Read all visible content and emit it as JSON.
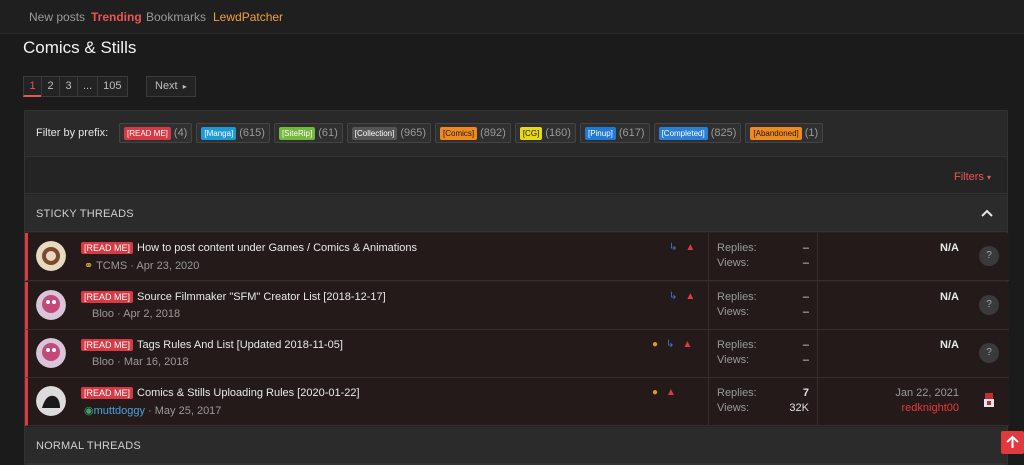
{
  "nav": {
    "new_posts": "New posts",
    "trending": "Trending",
    "bookmarks": "Bookmarks",
    "lewdpatcher": "LewdPatcher"
  },
  "page": {
    "title": "Comics & Stills"
  },
  "pagination": {
    "pages": [
      "1",
      "2",
      "3",
      "...",
      "105"
    ],
    "next": "Next",
    "current": "1"
  },
  "filter": {
    "label": "Filter by prefix:",
    "prefixes": [
      {
        "tag": "[READ ME]",
        "count": "(4)",
        "color": "#d63a44",
        "text_color": "#ffffff"
      },
      {
        "tag": "[Manga]",
        "count": "(615)",
        "color": "#1e9bd7",
        "text_color": "#ffffff"
      },
      {
        "tag": "[SiteRip]",
        "count": "(61)",
        "color": "#74b83c",
        "text_color": "#ffffff"
      },
      {
        "tag": "[Collection]",
        "count": "(965)",
        "color": "#555555",
        "text_color": "#ffffff"
      },
      {
        "tag": "[Comics]",
        "count": "(892)",
        "color": "#f08a1c",
        "text_color": "#1a1a1a"
      },
      {
        "tag": "[CG]",
        "count": "(160)",
        "color": "#e8d81a",
        "text_color": "#1a1a1a"
      },
      {
        "tag": "[Pinup]",
        "count": "(617)",
        "color": "#1e7ad6",
        "text_color": "#ffffff"
      },
      {
        "tag": "[Completed]",
        "count": "(825)",
        "color": "#2a80d6",
        "text_color": "#ffffff"
      },
      {
        "tag": "[Abandoned]",
        "count": "(1)",
        "color": "#f08a1c",
        "text_color": "#1a1a1a"
      }
    ],
    "filters_button": "Filters"
  },
  "sections": {
    "sticky": "STICKY THREADS",
    "normal": "NORMAL THREADS"
  },
  "threads": [
    {
      "prefix": "[READ ME]",
      "title": "How to post content under Games / Comics & Animations",
      "author": "TCMS",
      "date": "Apr 23, 2020",
      "replies_label": "Replies:",
      "replies": "–",
      "views_label": "Views:",
      "views": "–",
      "last": "N/A",
      "help": "?"
    },
    {
      "prefix": "[READ ME]",
      "title": "Source Filmmaker \"SFM\" Creator List [2018-12-17]",
      "author": "Bloo",
      "date": "Apr 2, 2018",
      "replies_label": "Replies:",
      "replies": "–",
      "views_label": "Views:",
      "views": "–",
      "last": "N/A",
      "help": "?"
    },
    {
      "prefix": "[READ ME]",
      "title": "Tags Rules And List [Updated 2018-11-05]",
      "author": "Bloo",
      "date": "Mar 16, 2018",
      "replies_label": "Replies:",
      "replies": "–",
      "views_label": "Views:",
      "views": "–",
      "last": "N/A",
      "help": "?"
    },
    {
      "prefix": "[READ ME]",
      "title": "Comics & Stills Uploading Rules [2020-01-22]",
      "author": "muttdoggy",
      "date": "May 25, 2017",
      "replies_label": "Replies:",
      "replies": "7",
      "views_label": "Views:",
      "views": "32K",
      "last_date": "Jan 22, 2021",
      "last_user": "redknight00"
    }
  ],
  "colors": {
    "accent": "#ec5555",
    "readme": "#d63a44"
  }
}
